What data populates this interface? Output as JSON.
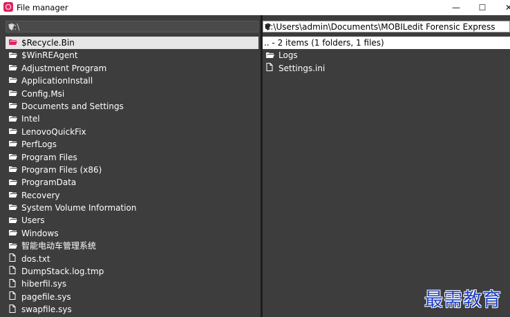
{
  "window": {
    "title": "File manager",
    "minimize": "—",
    "maximize": "☐",
    "close": "✕"
  },
  "left": {
    "path": "C:\\",
    "items": [
      {
        "name": "$Recycle.Bin",
        "type": "folder",
        "selected": true
      },
      {
        "name": "$WinREAgent",
        "type": "folder"
      },
      {
        "name": "Adjustment Program",
        "type": "folder"
      },
      {
        "name": "ApplicationInstall",
        "type": "folder"
      },
      {
        "name": "Config.Msi",
        "type": "folder"
      },
      {
        "name": "Documents and Settings",
        "type": "folder"
      },
      {
        "name": "Intel",
        "type": "folder"
      },
      {
        "name": "LenovoQuickFix",
        "type": "folder"
      },
      {
        "name": "PerfLogs",
        "type": "folder"
      },
      {
        "name": "Program Files",
        "type": "folder"
      },
      {
        "name": "Program Files (x86)",
        "type": "folder"
      },
      {
        "name": "ProgramData",
        "type": "folder"
      },
      {
        "name": "Recovery",
        "type": "folder"
      },
      {
        "name": "System Volume Information",
        "type": "folder"
      },
      {
        "name": "Users",
        "type": "folder"
      },
      {
        "name": "Windows",
        "type": "folder"
      },
      {
        "name": "智能电动车管理系统",
        "type": "folder"
      },
      {
        "name": "dos.txt",
        "type": "file"
      },
      {
        "name": "DumpStack.log.tmp",
        "type": "file"
      },
      {
        "name": "hiberfil.sys",
        "type": "file"
      },
      {
        "name": "pagefile.sys",
        "type": "file"
      },
      {
        "name": "swapfile.sys",
        "type": "file"
      }
    ]
  },
  "right": {
    "path": "C:\\Users\\admin\\Documents\\MOBILedit Forensic Express",
    "summary": ".. - 2 items (1 folders, 1 files)",
    "items": [
      {
        "name": "Logs",
        "type": "folder"
      },
      {
        "name": "Settings.ini",
        "type": "file"
      }
    ]
  },
  "watermark": "最需教育",
  "icons": {
    "folder": "folder-icon",
    "file": "file-icon",
    "dropdown": "chevron-down-icon"
  },
  "colors": {
    "background": "#3d3d3d",
    "selection": "#e5e5e5",
    "folder_icon": "#ffffff",
    "selected_folder_icon": "#e0245e",
    "watermark": "#1d3fbf"
  }
}
